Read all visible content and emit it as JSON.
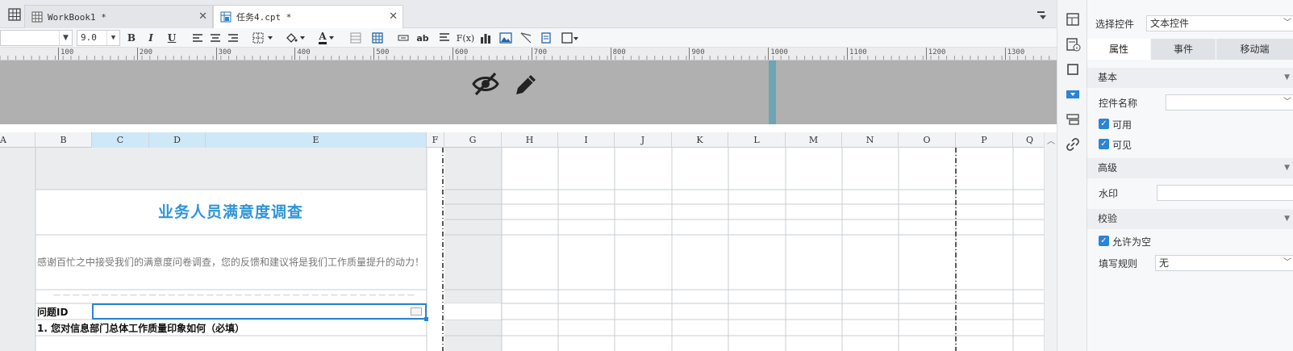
{
  "tabs": [
    {
      "label": "WorkBook1 *",
      "active": false
    },
    {
      "label": "任务4.cpt *",
      "active": true
    }
  ],
  "toolbar": {
    "font_name": "",
    "font_size": "9.0",
    "bold": "B",
    "italic": "I",
    "underline": "U",
    "text_style_label": "ab",
    "formula_label": "F(x)",
    "font_color_label": "A"
  },
  "ruler": {
    "ticks": [
      "100",
      "200",
      "300",
      "400",
      "500",
      "600",
      "700",
      "800",
      "900",
      "1000",
      "1100",
      "1200",
      "1300"
    ]
  },
  "column_headers": [
    "A",
    "B",
    "C",
    "D",
    "E",
    "F",
    "G",
    "H",
    "I",
    "J",
    "K",
    "L",
    "M",
    "N",
    "O",
    "P",
    "Q"
  ],
  "sheet": {
    "title": "业务人员满意度调查",
    "intro": "感谢百忙之中接受我们的满意度问卷调查，您的反馈和建议将是我们工作质量提升的动力！",
    "dashes": "— — — — — — — — — — — — — — — — — — — — — — — — — — — — — — — — — — — — — —",
    "qid_label": "问题ID",
    "question1": "1.   您对信息部门总体工作质量印象如何（必填）"
  },
  "panel": {
    "select_control_label": "选择控件",
    "select_control_value": "文本控件",
    "tabs": [
      "属性",
      "事件",
      "移动端"
    ],
    "section_basic": "基本",
    "control_name_label": "控件名称",
    "control_name_value": "",
    "enabled_label": "可用",
    "visible_label": "可见",
    "section_advanced": "高级",
    "watermark_label": "水印",
    "watermark_value": "",
    "section_validation": "校验",
    "allow_empty_label": "允许为空",
    "fill_rule_label": "填写规则",
    "fill_rule_value": "无"
  },
  "colors": {
    "accent": "#2b84d6",
    "title_blue": "#2f95d8",
    "hidden_band": "#b0b0b0",
    "selected_header": "#cfe8f7"
  }
}
